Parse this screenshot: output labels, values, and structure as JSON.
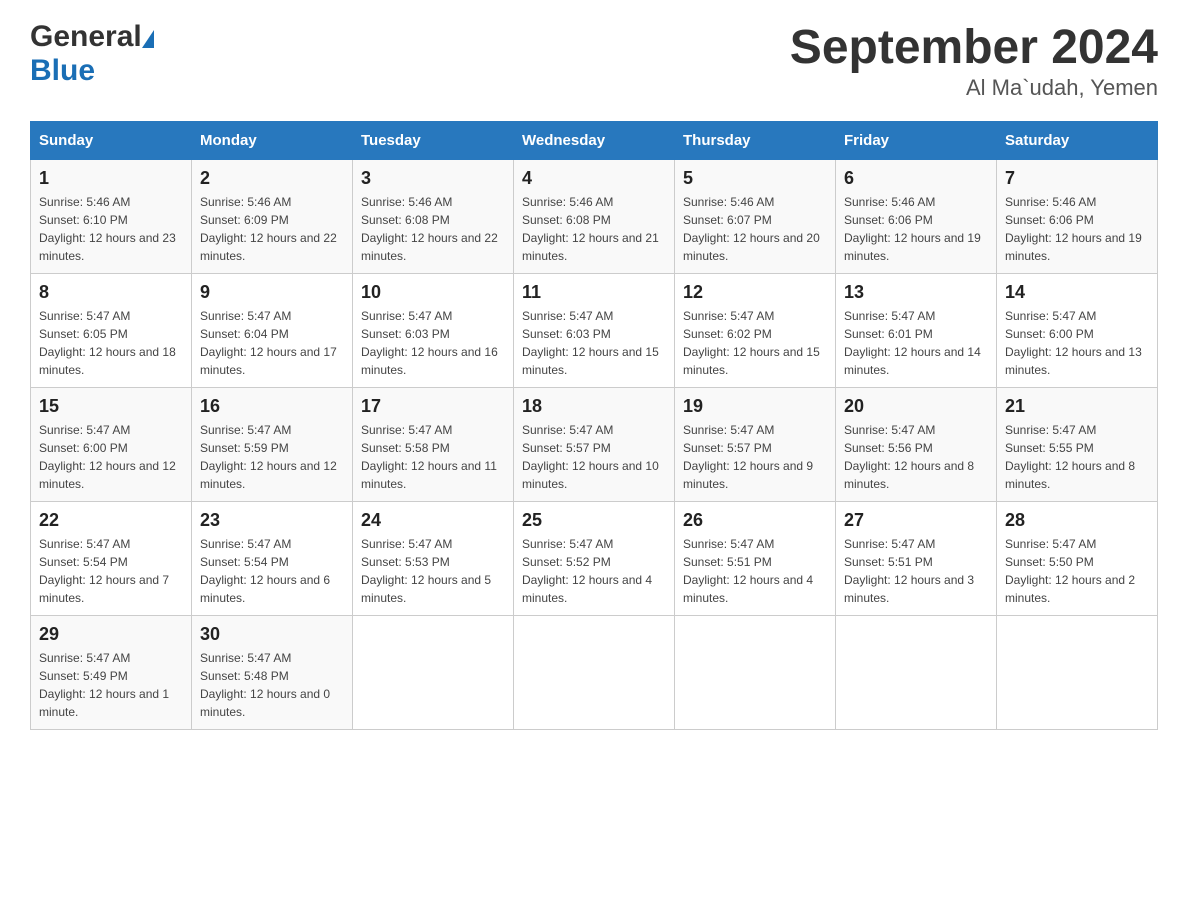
{
  "header": {
    "logo_general": "General",
    "logo_blue": "Blue",
    "title": "September 2024",
    "subtitle": "Al Ma`udah, Yemen"
  },
  "days_of_week": [
    "Sunday",
    "Monday",
    "Tuesday",
    "Wednesday",
    "Thursday",
    "Friday",
    "Saturday"
  ],
  "weeks": [
    [
      {
        "day": "1",
        "sunrise": "Sunrise: 5:46 AM",
        "sunset": "Sunset: 6:10 PM",
        "daylight": "Daylight: 12 hours and 23 minutes."
      },
      {
        "day": "2",
        "sunrise": "Sunrise: 5:46 AM",
        "sunset": "Sunset: 6:09 PM",
        "daylight": "Daylight: 12 hours and 22 minutes."
      },
      {
        "day": "3",
        "sunrise": "Sunrise: 5:46 AM",
        "sunset": "Sunset: 6:08 PM",
        "daylight": "Daylight: 12 hours and 22 minutes."
      },
      {
        "day": "4",
        "sunrise": "Sunrise: 5:46 AM",
        "sunset": "Sunset: 6:08 PM",
        "daylight": "Daylight: 12 hours and 21 minutes."
      },
      {
        "day": "5",
        "sunrise": "Sunrise: 5:46 AM",
        "sunset": "Sunset: 6:07 PM",
        "daylight": "Daylight: 12 hours and 20 minutes."
      },
      {
        "day": "6",
        "sunrise": "Sunrise: 5:46 AM",
        "sunset": "Sunset: 6:06 PM",
        "daylight": "Daylight: 12 hours and 19 minutes."
      },
      {
        "day": "7",
        "sunrise": "Sunrise: 5:46 AM",
        "sunset": "Sunset: 6:06 PM",
        "daylight": "Daylight: 12 hours and 19 minutes."
      }
    ],
    [
      {
        "day": "8",
        "sunrise": "Sunrise: 5:47 AM",
        "sunset": "Sunset: 6:05 PM",
        "daylight": "Daylight: 12 hours and 18 minutes."
      },
      {
        "day": "9",
        "sunrise": "Sunrise: 5:47 AM",
        "sunset": "Sunset: 6:04 PM",
        "daylight": "Daylight: 12 hours and 17 minutes."
      },
      {
        "day": "10",
        "sunrise": "Sunrise: 5:47 AM",
        "sunset": "Sunset: 6:03 PM",
        "daylight": "Daylight: 12 hours and 16 minutes."
      },
      {
        "day": "11",
        "sunrise": "Sunrise: 5:47 AM",
        "sunset": "Sunset: 6:03 PM",
        "daylight": "Daylight: 12 hours and 15 minutes."
      },
      {
        "day": "12",
        "sunrise": "Sunrise: 5:47 AM",
        "sunset": "Sunset: 6:02 PM",
        "daylight": "Daylight: 12 hours and 15 minutes."
      },
      {
        "day": "13",
        "sunrise": "Sunrise: 5:47 AM",
        "sunset": "Sunset: 6:01 PM",
        "daylight": "Daylight: 12 hours and 14 minutes."
      },
      {
        "day": "14",
        "sunrise": "Sunrise: 5:47 AM",
        "sunset": "Sunset: 6:00 PM",
        "daylight": "Daylight: 12 hours and 13 minutes."
      }
    ],
    [
      {
        "day": "15",
        "sunrise": "Sunrise: 5:47 AM",
        "sunset": "Sunset: 6:00 PM",
        "daylight": "Daylight: 12 hours and 12 minutes."
      },
      {
        "day": "16",
        "sunrise": "Sunrise: 5:47 AM",
        "sunset": "Sunset: 5:59 PM",
        "daylight": "Daylight: 12 hours and 12 minutes."
      },
      {
        "day": "17",
        "sunrise": "Sunrise: 5:47 AM",
        "sunset": "Sunset: 5:58 PM",
        "daylight": "Daylight: 12 hours and 11 minutes."
      },
      {
        "day": "18",
        "sunrise": "Sunrise: 5:47 AM",
        "sunset": "Sunset: 5:57 PM",
        "daylight": "Daylight: 12 hours and 10 minutes."
      },
      {
        "day": "19",
        "sunrise": "Sunrise: 5:47 AM",
        "sunset": "Sunset: 5:57 PM",
        "daylight": "Daylight: 12 hours and 9 minutes."
      },
      {
        "day": "20",
        "sunrise": "Sunrise: 5:47 AM",
        "sunset": "Sunset: 5:56 PM",
        "daylight": "Daylight: 12 hours and 8 minutes."
      },
      {
        "day": "21",
        "sunrise": "Sunrise: 5:47 AM",
        "sunset": "Sunset: 5:55 PM",
        "daylight": "Daylight: 12 hours and 8 minutes."
      }
    ],
    [
      {
        "day": "22",
        "sunrise": "Sunrise: 5:47 AM",
        "sunset": "Sunset: 5:54 PM",
        "daylight": "Daylight: 12 hours and 7 minutes."
      },
      {
        "day": "23",
        "sunrise": "Sunrise: 5:47 AM",
        "sunset": "Sunset: 5:54 PM",
        "daylight": "Daylight: 12 hours and 6 minutes."
      },
      {
        "day": "24",
        "sunrise": "Sunrise: 5:47 AM",
        "sunset": "Sunset: 5:53 PM",
        "daylight": "Daylight: 12 hours and 5 minutes."
      },
      {
        "day": "25",
        "sunrise": "Sunrise: 5:47 AM",
        "sunset": "Sunset: 5:52 PM",
        "daylight": "Daylight: 12 hours and 4 minutes."
      },
      {
        "day": "26",
        "sunrise": "Sunrise: 5:47 AM",
        "sunset": "Sunset: 5:51 PM",
        "daylight": "Daylight: 12 hours and 4 minutes."
      },
      {
        "day": "27",
        "sunrise": "Sunrise: 5:47 AM",
        "sunset": "Sunset: 5:51 PM",
        "daylight": "Daylight: 12 hours and 3 minutes."
      },
      {
        "day": "28",
        "sunrise": "Sunrise: 5:47 AM",
        "sunset": "Sunset: 5:50 PM",
        "daylight": "Daylight: 12 hours and 2 minutes."
      }
    ],
    [
      {
        "day": "29",
        "sunrise": "Sunrise: 5:47 AM",
        "sunset": "Sunset: 5:49 PM",
        "daylight": "Daylight: 12 hours and 1 minute."
      },
      {
        "day": "30",
        "sunrise": "Sunrise: 5:47 AM",
        "sunset": "Sunset: 5:48 PM",
        "daylight": "Daylight: 12 hours and 0 minutes."
      },
      null,
      null,
      null,
      null,
      null
    ]
  ]
}
